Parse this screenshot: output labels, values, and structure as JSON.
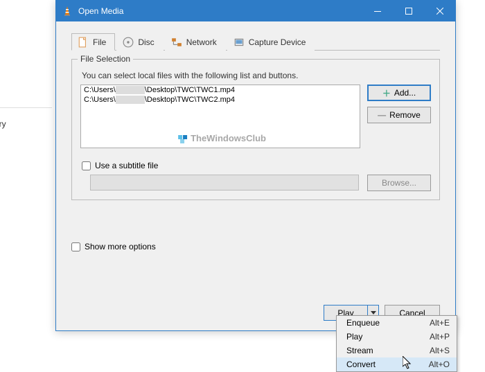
{
  "bg_sidebar_label": "ery",
  "window": {
    "title": "Open Media",
    "tabs": [
      {
        "id": "file",
        "label": "File",
        "active": true
      },
      {
        "id": "disc",
        "label": "Disc",
        "active": false
      },
      {
        "id": "network",
        "label": "Network",
        "active": false
      },
      {
        "id": "capture",
        "label": "Capture Device",
        "active": false
      }
    ],
    "file_selection": {
      "legend": "File Selection",
      "hint": "You can select local files with the following list and buttons.",
      "files": [
        {
          "prefix": "C:\\Users\\",
          "suffix": "\\Desktop\\TWC\\TWC1.mp4"
        },
        {
          "prefix": "C:\\Users\\",
          "suffix": "\\Desktop\\TWC\\TWC2.mp4"
        }
      ],
      "add_label": "Add...",
      "remove_label": "Remove",
      "watermark": "TheWindowsClub"
    },
    "subtitle": {
      "checkbox_label": "Use a subtitle file",
      "browse_label": "Browse..."
    },
    "show_more_label": "Show more options",
    "play_label": "Play",
    "cancel_label": "Cancel"
  },
  "dropdown": {
    "items": [
      {
        "label": "Enqueue",
        "shortcut": "Alt+E",
        "hover": false
      },
      {
        "label": "Play",
        "shortcut": "Alt+P",
        "hover": false
      },
      {
        "label": "Stream",
        "shortcut": "Alt+S",
        "hover": false
      },
      {
        "label": "Convert",
        "shortcut": "Alt+O",
        "hover": true
      }
    ]
  }
}
